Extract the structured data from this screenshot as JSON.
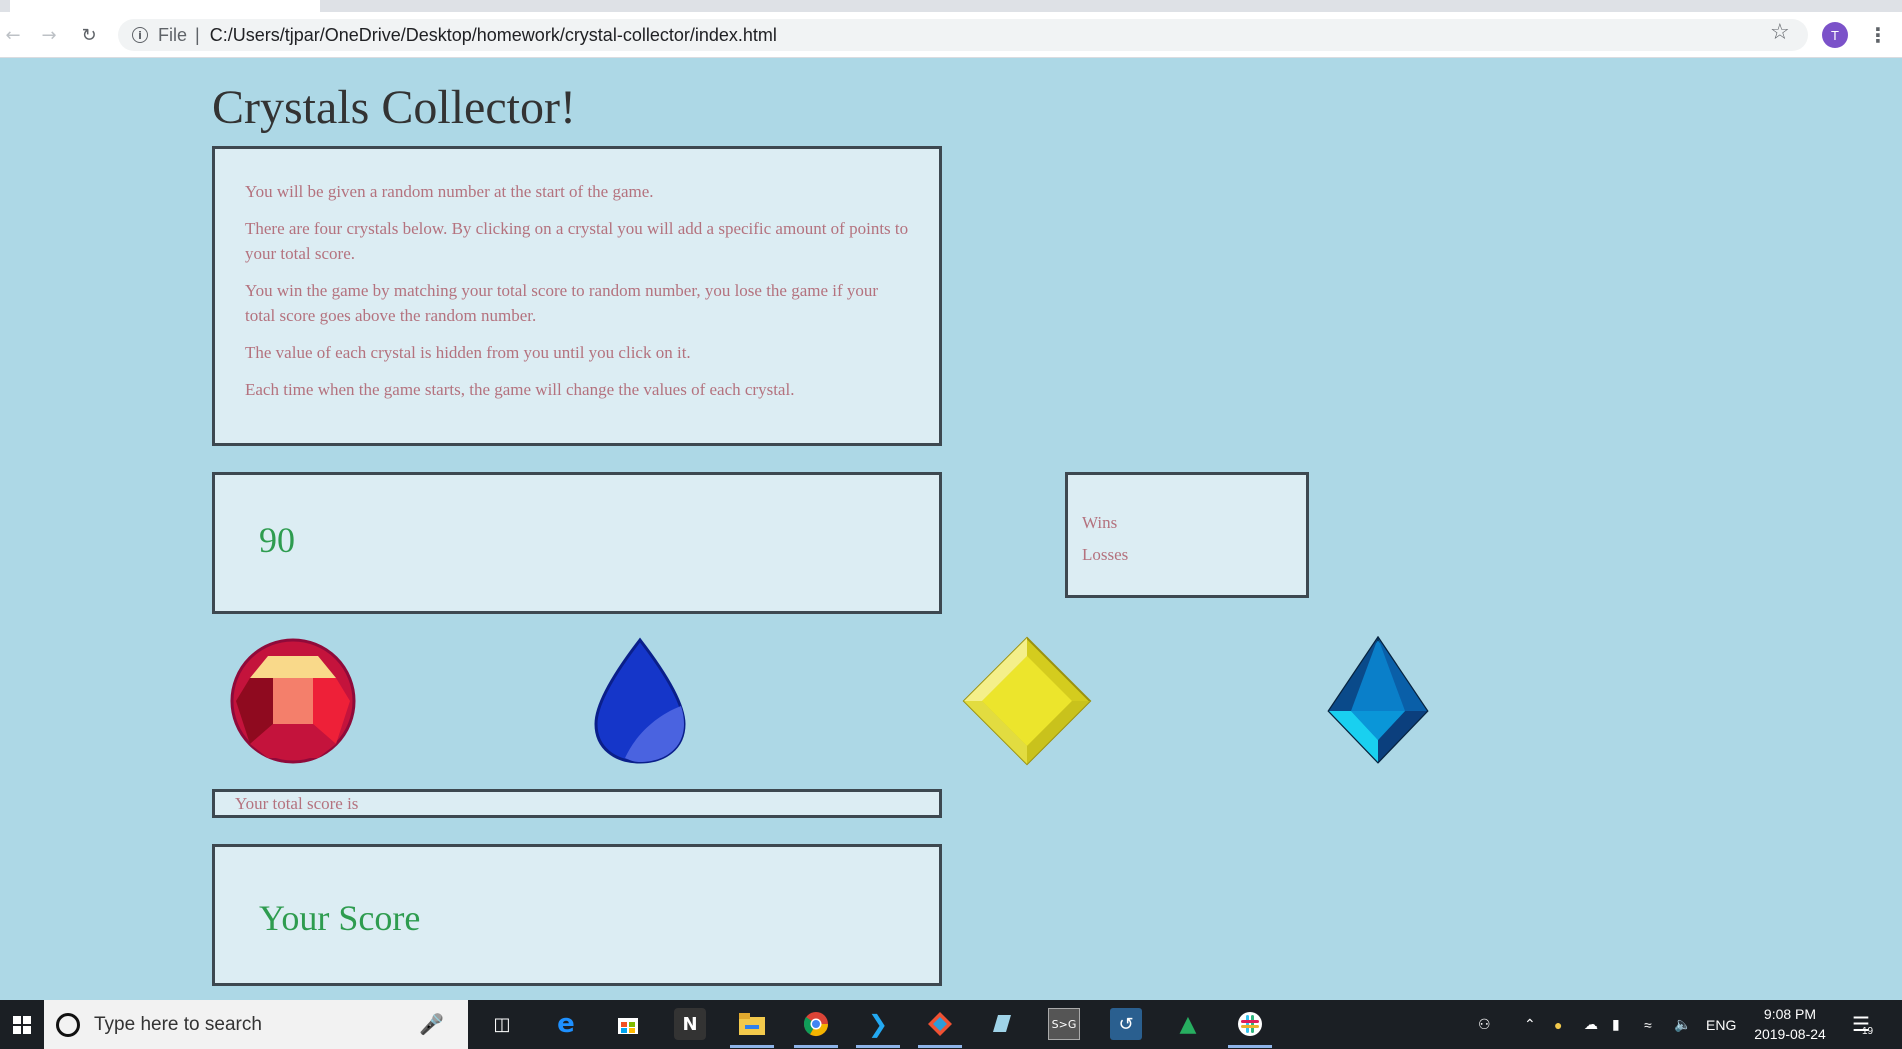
{
  "browser": {
    "url_scheme": "File",
    "url_separator": "|",
    "url": "C:/Users/tjpar/OneDrive/Desktop/homework/crystal-collector/index.html",
    "profile_initial": "T"
  },
  "page": {
    "title": "Crystals Collector!",
    "instructions": [
      "You will be given a random number at the start of the game.",
      "There are four crystals below. By clicking on a crystal you will add a specific amount of points to your total score.",
      "You win the game by matching your total score to random number, you lose the game if your total score goes above the random number.",
      "The value of each crystal is hidden from you until you click on it.",
      "Each time when the game starts, the game will change the values of each crystal."
    ],
    "target_number": "90",
    "stats": {
      "wins_label": "Wins",
      "losses_label": "Losses"
    },
    "score_label": "Your total score is",
    "score_text": "Your Score",
    "crystals": [
      {
        "name": "red-crystal",
        "colors": [
          "#c4133c",
          "#f9d98a",
          "#f47f6b",
          "#8f0a1f"
        ]
      },
      {
        "name": "blue-drop-crystal",
        "colors": [
          "#1536c9",
          "#4a63e0"
        ]
      },
      {
        "name": "yellow-diamond-crystal",
        "colors": [
          "#e8e42c",
          "#f4ef6a",
          "#c9c21c"
        ]
      },
      {
        "name": "blue-kite-crystal",
        "colors": [
          "#0a7fc9",
          "#0a4a8a",
          "#19d0f0"
        ]
      }
    ]
  },
  "taskbar": {
    "search_placeholder": "Type here to search",
    "language": "ENG",
    "time": "9:08 PM",
    "date": "2019-08-24",
    "notification_count": "19"
  }
}
